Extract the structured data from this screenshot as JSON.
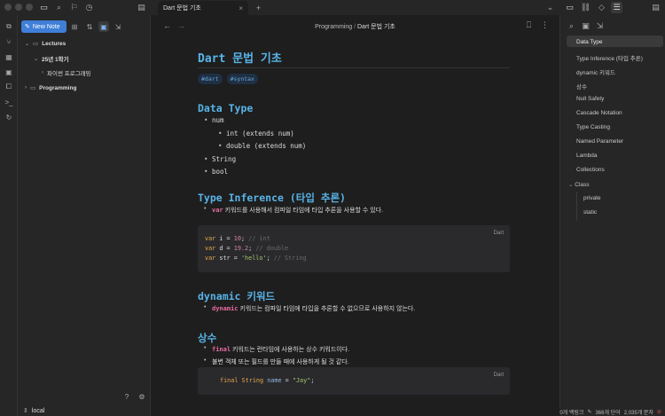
{
  "tab": {
    "title": "Dart 문법 기초"
  },
  "sidebar": {
    "new_note": "New Note",
    "tree": [
      {
        "label": "Lectures",
        "expanded": true
      },
      {
        "label": "25년 1학기",
        "expanded": true
      },
      {
        "label": "파이썬 프로그래밍",
        "expanded": false
      },
      {
        "label": "Programming",
        "expanded": true
      }
    ],
    "vault": "local"
  },
  "breadcrumb": {
    "folder": "Programming",
    "separator": "/",
    "file": "Dart 문법 기초"
  },
  "doc": {
    "title": "Dart 문법 기초",
    "tags": [
      "#dart",
      "#syntax"
    ],
    "sec1": {
      "heading": "Data Type",
      "items": [
        "num",
        "int (extends num)",
        "double (extends num)",
        "String",
        "bool"
      ]
    },
    "sec2": {
      "heading": "Type Inference (타입 추론)",
      "kw": "var",
      "text": " 키워드를 사용해서 컴파일 타임에 타입 추론을 사용할 수 있다.",
      "lang": "Dart",
      "code": [
        {
          "kw": "var",
          "id": " i = ",
          "val": "10",
          "end": "; ",
          "com": "// int"
        },
        {
          "kw": "var",
          "id": " d = ",
          "val": "19.2",
          "end": "; ",
          "com": "// double"
        },
        {
          "kw": "var",
          "id": " str = ",
          "val": "'hello'",
          "end": "; ",
          "com": "// String"
        }
      ]
    },
    "sec3": {
      "heading": "dynamic 키워드",
      "kw": "dynamic",
      "text": " 키워드는 컴파일 타임에 타입을 추론할 수 없으므로 사용하지 않는다."
    },
    "sec4": {
      "heading": "상수",
      "kw": "final",
      "text1": " 키워드는 런타임에 사용하는 상수 키워드이다.",
      "text2": "불변 객체 또는 필드를 만들 때에 사용하게 될 것 같다.",
      "lang": "Dart",
      "code_kw": "final",
      "code_type": " String",
      "code_var": " name",
      "code_eq": " = ",
      "code_str": "\"Jay\"",
      "code_end": ";"
    }
  },
  "outline": [
    "Data Type",
    "Type Inference (타입 추론)",
    "dynamic 키워드",
    "상수",
    "Null Safety",
    "Cascade Notation",
    "Type Casting",
    "Named Parameter",
    "Lambda",
    "Collections",
    "Class",
    "private",
    "static"
  ],
  "status": {
    "backlinks": "0개 백링크",
    "words": "366개 단어",
    "chars": "2,035개 문자"
  }
}
